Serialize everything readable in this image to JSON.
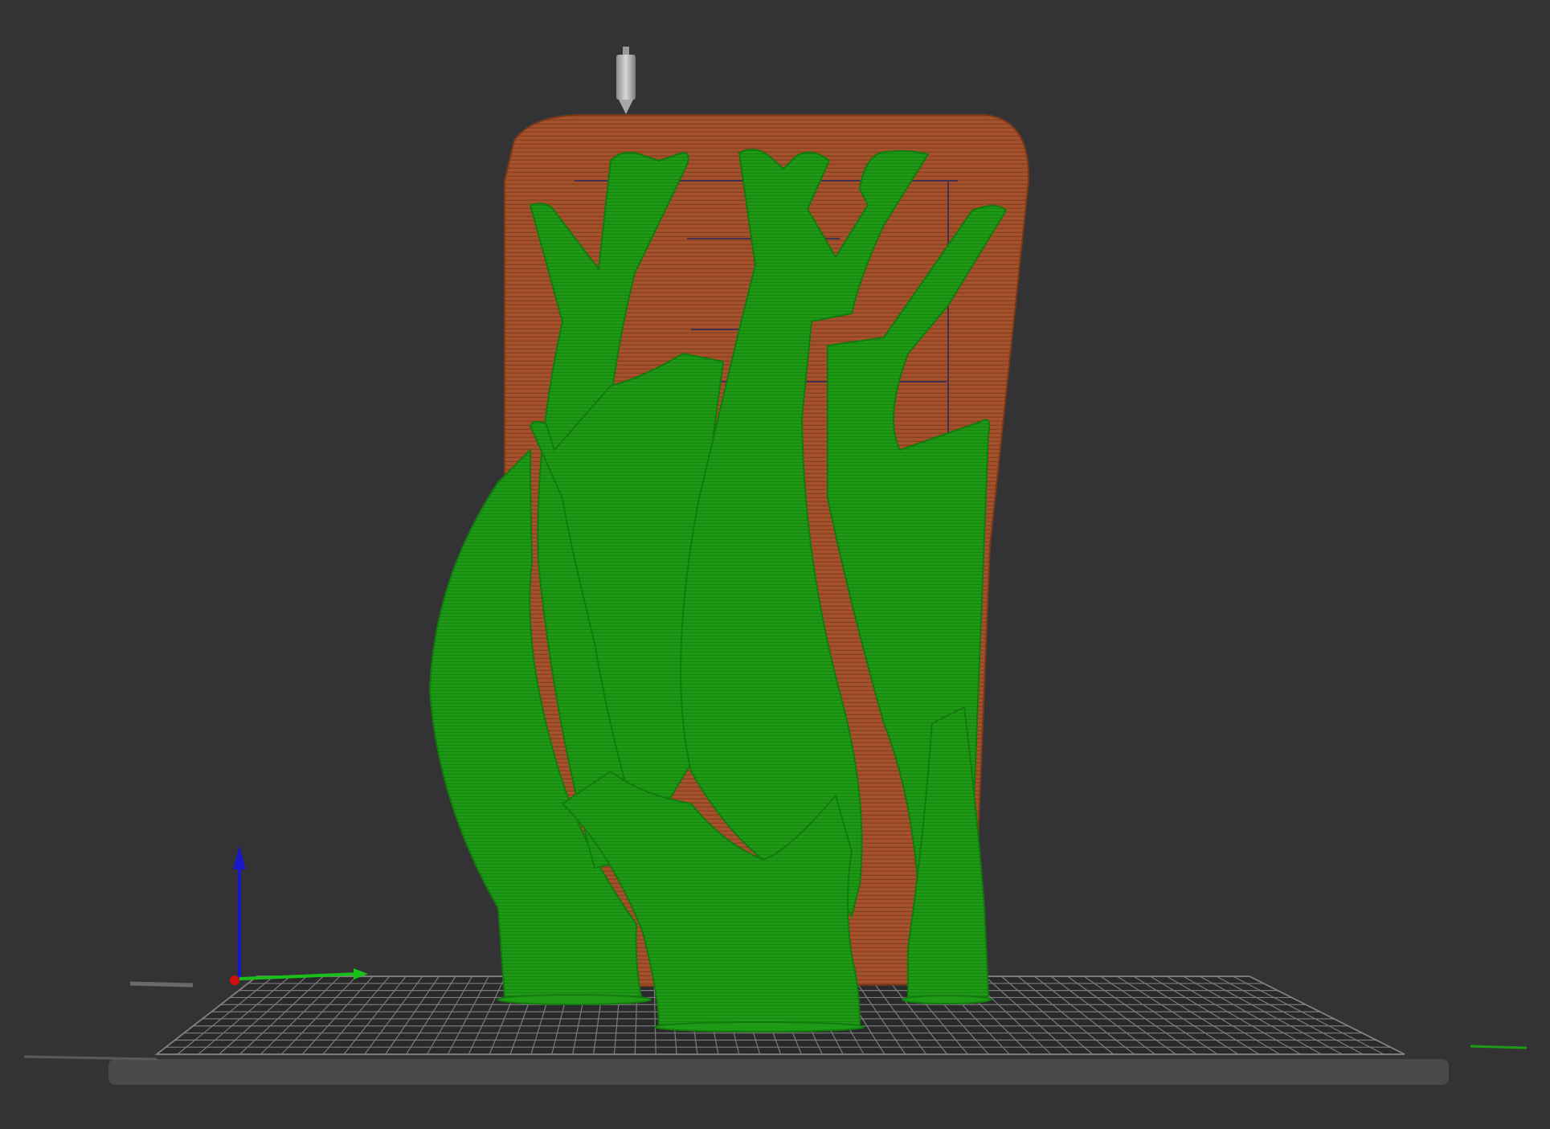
{
  "app": {
    "view": "3d-gcode-preview"
  },
  "colors": {
    "background": "#333335",
    "bed_surface": "#2a2a2c",
    "bed_grid": "#8a8a8c",
    "bed_frame": "#4a4a4c",
    "model": "#a5522c",
    "model_edge": "#8a4220",
    "support": "#1f9a16",
    "support_edge": "#137a0d",
    "nozzle": "#b8b8b8",
    "axis_x": "#d01010",
    "axis_y": "#18c018",
    "axis_z": "#1818c8"
  },
  "icons": {
    "nozzle": "print-head-nozzle-icon",
    "axes": "xyz-axes-gizmo-icon"
  }
}
